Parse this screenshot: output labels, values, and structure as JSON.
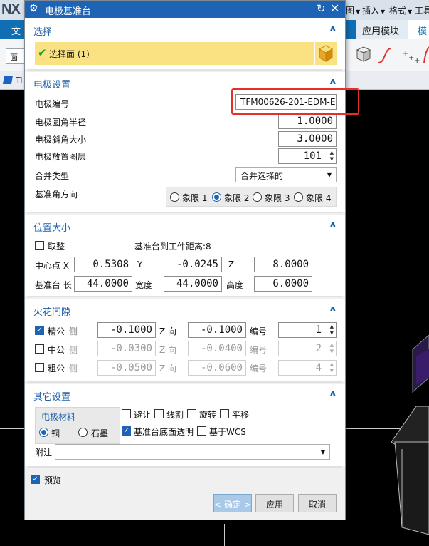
{
  "app": {
    "logo": "NX",
    "menu": [
      {
        "label": "图"
      },
      {
        "label": "插入"
      },
      {
        "label": "格式"
      },
      {
        "label": "工具"
      }
    ],
    "ribbon_left_tab": "文",
    "ribbon_tabs": {
      "app_module": "应用模块",
      "mold": "模具"
    },
    "filter_value": "面",
    "nav_label": "Ti"
  },
  "dialog": {
    "title": "电极基准台",
    "select_section": {
      "header": "选择",
      "item_label": "选择面 (1)"
    },
    "electrode_settings": {
      "header": "电极设置",
      "number_label": "电极编号",
      "number_value": "TFM00626-201-EDM-E",
      "corner_radius_label": "电极圆角半径",
      "corner_radius_value": "1.0000",
      "chamfer_label": "电极斜角大小",
      "chamfer_value": "3.0000",
      "layer_label": "电极放置图层",
      "layer_value": "101",
      "merge_type_label": "合并类型",
      "merge_type_value": "合并选择的",
      "ref_corner_label": "基准角方向",
      "quadrants": [
        "象限 1",
        "象限 2",
        "象限 3",
        "象限 4"
      ],
      "selected_quadrant": "象限 2"
    },
    "position_size": {
      "header": "位置大小",
      "round_label": "取整",
      "distance_text": "基准台到工件距离:8",
      "center_label": "中心点 X",
      "center_x": "0.5308",
      "y_label": "Y",
      "center_y": "-0.0245",
      "z_label": "Z",
      "center_z": "8.0000",
      "base_length_label": "基准台 长",
      "length_value": "44.0000",
      "width_label": "宽度",
      "width_value": "44.0000",
      "height_label": "高度",
      "height_value": "6.0000"
    },
    "spark_gap": {
      "header": "火花间隙",
      "side_label": "侧",
      "z_label": "Z 向",
      "number_label": "编号",
      "rows": [
        {
          "name": "精公",
          "checked": true,
          "side": "-0.1000",
          "z": "-0.1000",
          "number": "1"
        },
        {
          "name": "中公",
          "checked": false,
          "side": "-0.0300",
          "z": "-0.0400",
          "number": "2"
        },
        {
          "name": "粗公",
          "checked": false,
          "side": "-0.0500",
          "z": "-0.0600",
          "number": "4"
        }
      ]
    },
    "other_settings": {
      "header": "其它设置",
      "material_group_label": "电极材料",
      "material_copper": "铜",
      "material_graphite": "石墨",
      "selected_material": "铜",
      "opt_avoid": "避让",
      "opt_wire_cut": "线割",
      "opt_rotate": "旋转",
      "opt_translate": "平移",
      "opt_transparent": "基准台底面透明",
      "opt_wcs": "基于WCS",
      "note_label": "附注",
      "note_value": ""
    },
    "preview_label": "预览",
    "buttons": {
      "ok": "< 确定 >",
      "apply": "应用",
      "cancel": "取消"
    }
  },
  "colors": {
    "title_bar": "#1f64b4",
    "section_header": "#1b5fa8",
    "selection_bar": "#fae181",
    "highlight_box": "#e5302a",
    "ribbon": "#0f6fb2"
  }
}
